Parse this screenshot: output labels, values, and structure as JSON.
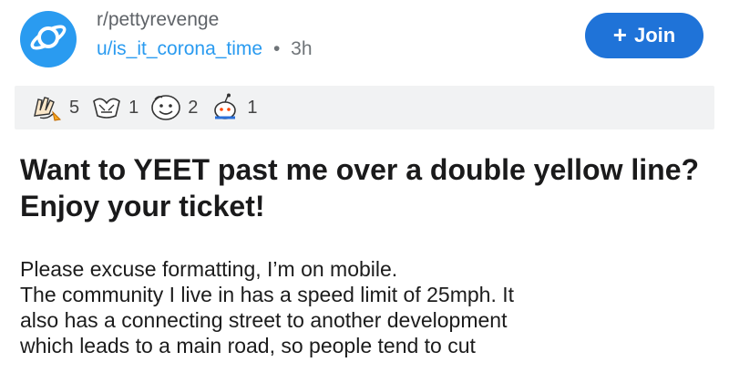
{
  "post": {
    "subreddit": "r/pettyrevenge",
    "author": "u/is_it_corona_time",
    "separator": "•",
    "age": "3h",
    "join_label": "Join",
    "join_icon": "plus-icon",
    "awards": [
      {
        "icon": "clapping-hands-award-icon",
        "count": "5"
      },
      {
        "icon": "hands-award-icon",
        "count": "1"
      },
      {
        "icon": "face-award-icon",
        "count": "2"
      },
      {
        "icon": "snoo-award-icon",
        "count": "1"
      }
    ],
    "title": "Want to YEET past me over a double yellow line? Enjoy your ticket!",
    "body_lines": [
      "Please excuse formatting, I’m on mobile.",
      "The community I live in has a speed limit of 25mph. It",
      "also has a connecting street to another development",
      "which leads to a main road, so people tend to cut"
    ]
  },
  "colors": {
    "accent_blue": "#1f73d8",
    "avatar_blue": "#2a9bf0",
    "awards_bg": "#f1f2f3"
  }
}
